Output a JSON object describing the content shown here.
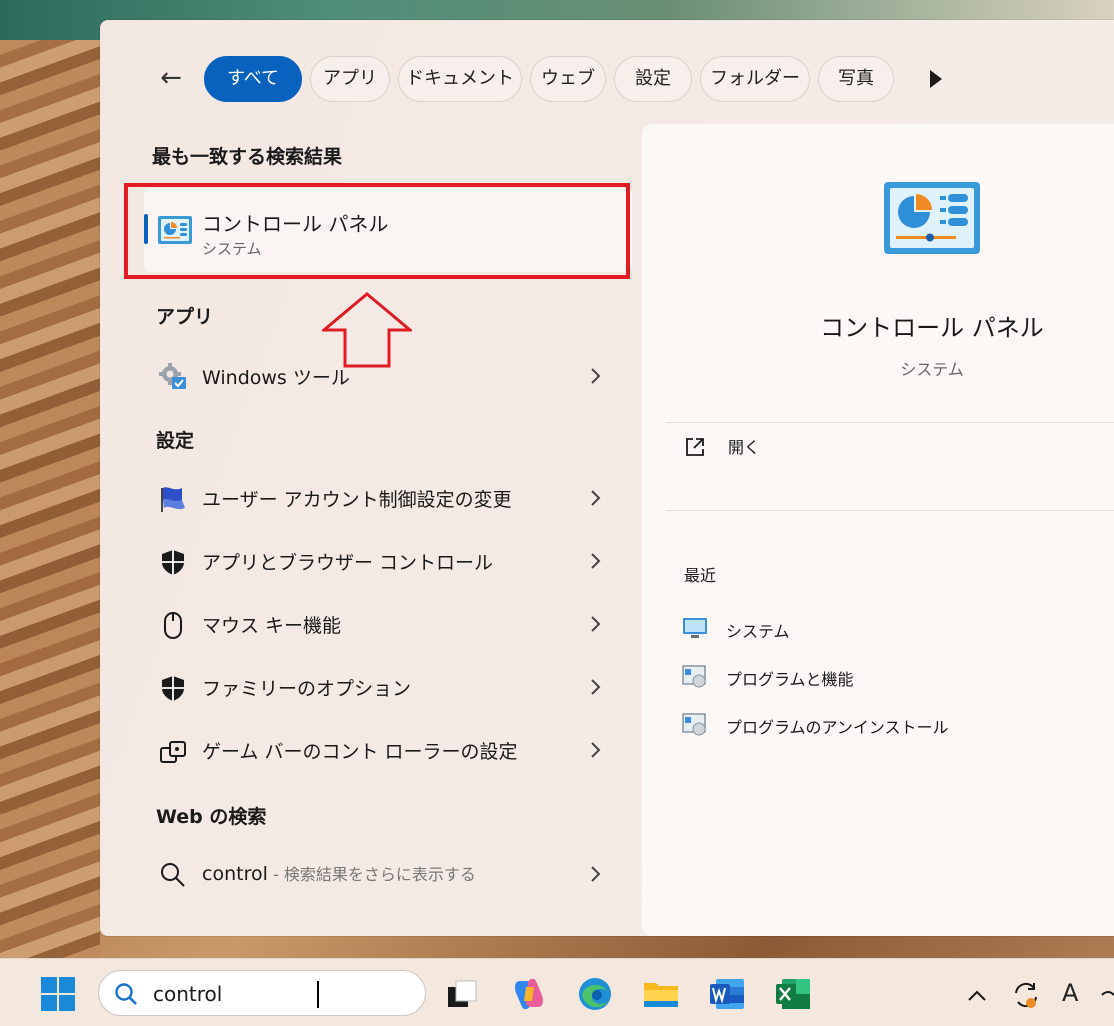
{
  "filters": {
    "back_label": "←",
    "chips": [
      "すべて",
      "アプリ",
      "ドキュメント",
      "ウェブ",
      "設定",
      "フォルダー",
      "写真"
    ]
  },
  "sections": {
    "best_match": "最も一致する検索結果",
    "apps": "アプリ",
    "settings": "設定",
    "web": "Web の検索"
  },
  "best_match": {
    "title": "コントロール パネル",
    "subtitle": "システム"
  },
  "apps": [
    {
      "label": "Windows ツール",
      "icon": "windows-tools-icon"
    }
  ],
  "settings": [
    {
      "label": "ユーザー アカウント制御設定の変更",
      "icon": "uac-flag-icon"
    },
    {
      "label": "アプリとブラウザー コントロール",
      "icon": "shield-icon"
    },
    {
      "label": "マウス キー機能",
      "icon": "mouse-icon"
    },
    {
      "label": "ファミリーのオプション",
      "icon": "shield-icon"
    },
    {
      "label": "ゲーム バーのコント ローラーの設定",
      "icon": "gamepad-icon"
    }
  ],
  "web": {
    "query": "control",
    "suffix": " - 検索結果をさらに表示する"
  },
  "preview": {
    "title": "コントロール パネル",
    "subtitle": "システム",
    "open_label": "開く",
    "recent_heading": "最近",
    "recent": [
      "システム",
      "プログラムと機能",
      "プログラムのアンインストール"
    ]
  },
  "taskbar": {
    "search_value": "control",
    "tray_font_label": "A"
  },
  "colors": {
    "accent": "#0a62bf",
    "highlight": "#e01b24"
  }
}
